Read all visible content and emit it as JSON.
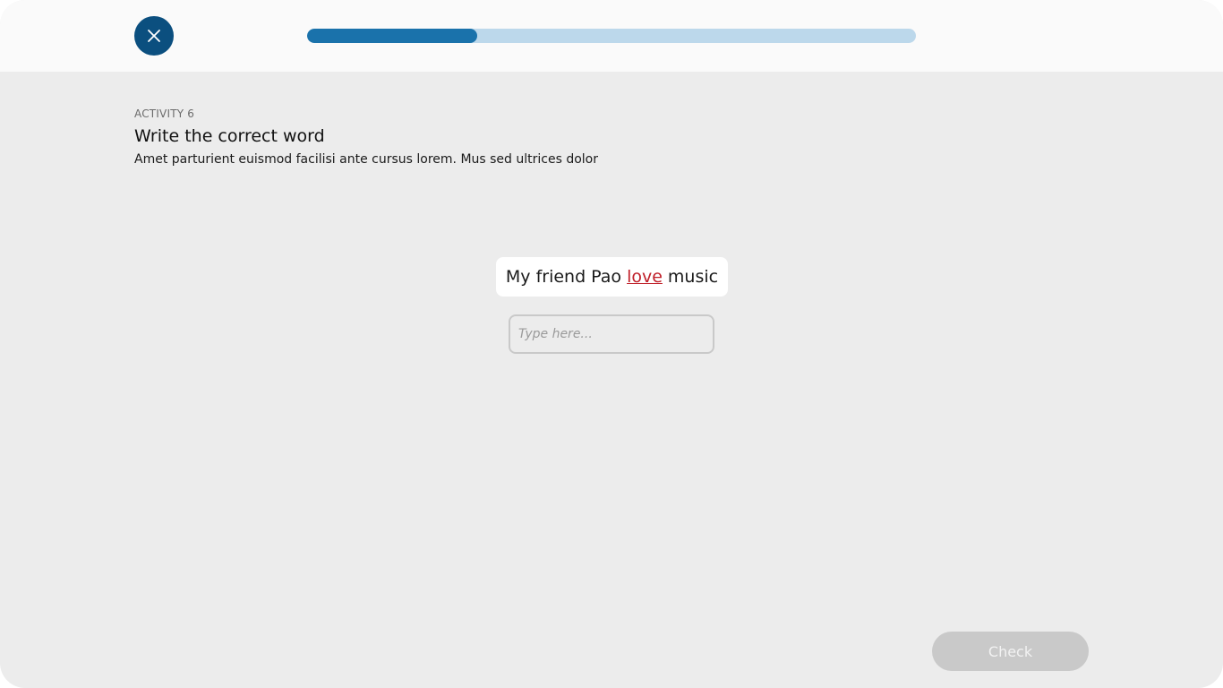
{
  "header": {
    "close_icon": "close-icon",
    "progress": 0.28,
    "colors": {
      "close_bg": "#0b4f7f",
      "progress_fill": "#1a72ab",
      "progress_track": "#bcd8eb"
    }
  },
  "activity": {
    "label": "ACTIVITY 6",
    "title": "Write the correct word",
    "description": "Amet parturient euismod facilisi ante cursus lorem. Mus sed ultrices dolor"
  },
  "sentence": {
    "before": "My friend Pao",
    "highlighted": "love",
    "after": "music",
    "highlight_color": "#c0202a"
  },
  "answer": {
    "value": "",
    "placeholder": "Type here..."
  },
  "footer": {
    "check_label": "Check",
    "check_disabled": true
  }
}
